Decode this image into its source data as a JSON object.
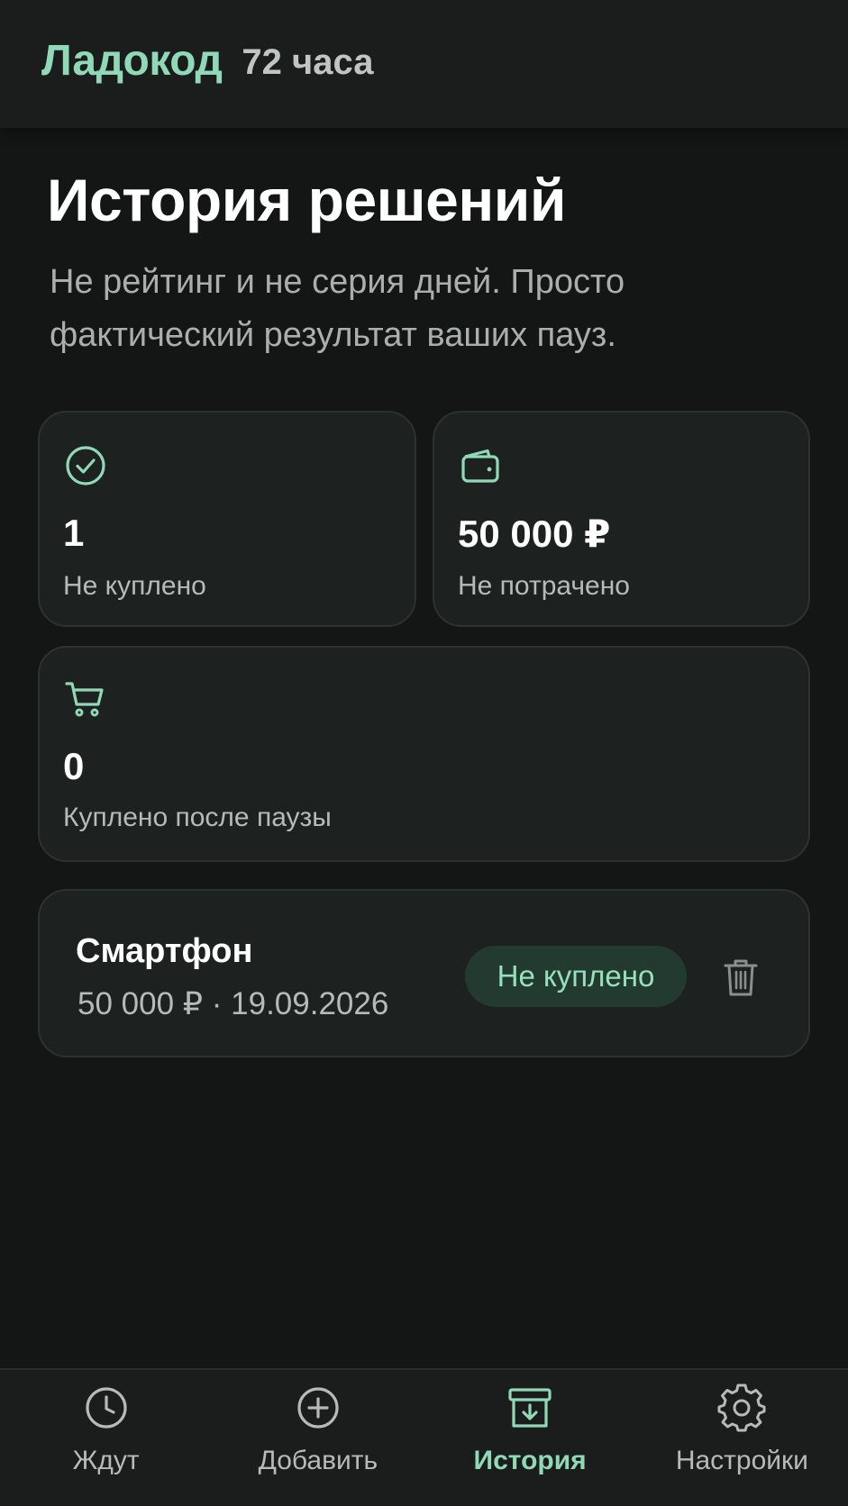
{
  "header": {
    "brand": "Ладокод",
    "subtitle": "72 часа"
  },
  "page": {
    "title": "История решений",
    "subtitle": "Не рейтинг и не серия дней. Просто фактический результат ваших пауз."
  },
  "stats": [
    {
      "icon": "check-circle-icon",
      "value": "1",
      "label": "Не куплено"
    },
    {
      "icon": "wallet-icon",
      "value": "50 000 ₽",
      "label": "Не потрачено"
    },
    {
      "icon": "cart-icon",
      "value": "0",
      "label": "Куплено после паузы"
    }
  ],
  "history": [
    {
      "name": "Смартфон",
      "meta": "50 000 ₽ · 19.09.2026",
      "status": "Не куплено",
      "delete_icon": "trash-icon"
    }
  ],
  "nav": [
    {
      "icon": "clock-icon",
      "label": "Ждут",
      "active": false
    },
    {
      "icon": "plus-circle-icon",
      "label": "Добавить",
      "active": false
    },
    {
      "icon": "archive-icon",
      "label": "История",
      "active": true
    },
    {
      "icon": "gear-icon",
      "label": "Настройки",
      "active": false
    }
  ],
  "colors": {
    "accent": "#8fd9b6",
    "background": "#141615",
    "card": "#1d211f",
    "badge_bg": "#223a30"
  }
}
